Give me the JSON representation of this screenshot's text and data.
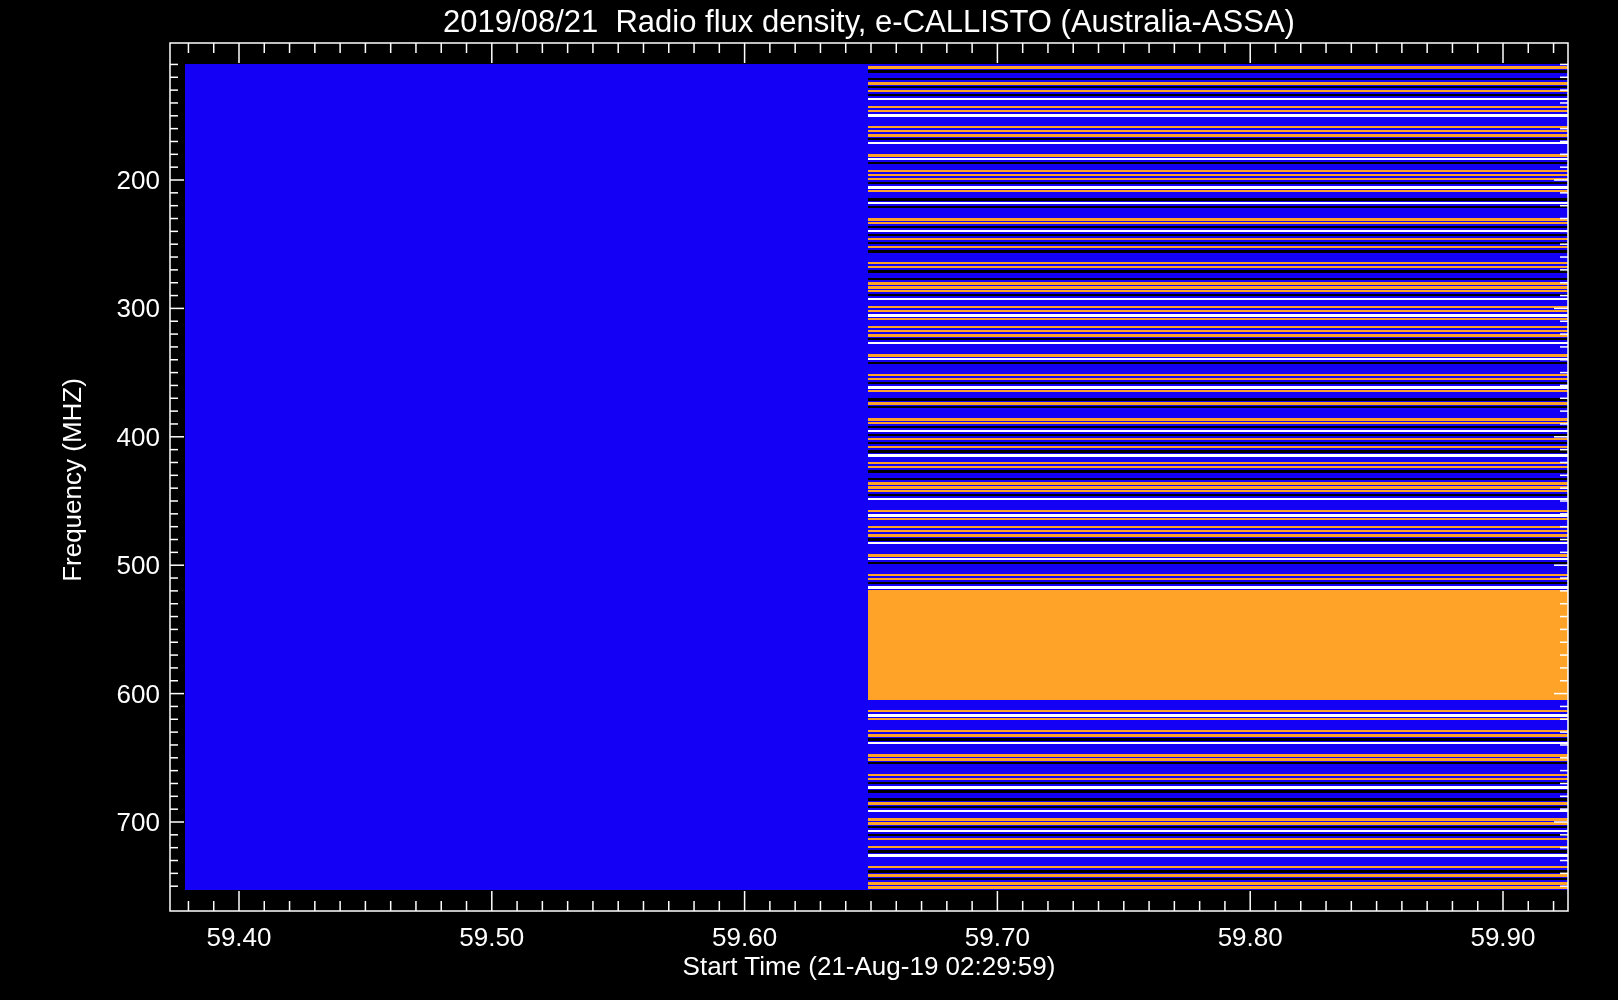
{
  "title": "2019/08/21  Radio flux density, e-CALLISTO (Australia-ASSA)",
  "y_axis": {
    "label": "Frequency (MHZ)",
    "ticks": [
      "200",
      "300",
      "400",
      "500",
      "600",
      "700"
    ]
  },
  "x_axis": {
    "label": "Start Time (21-Aug-19 02:29:59)",
    "ticks": [
      "59.40",
      "59.50",
      "59.60",
      "59.70",
      "59.80",
      "59.90"
    ]
  }
}
